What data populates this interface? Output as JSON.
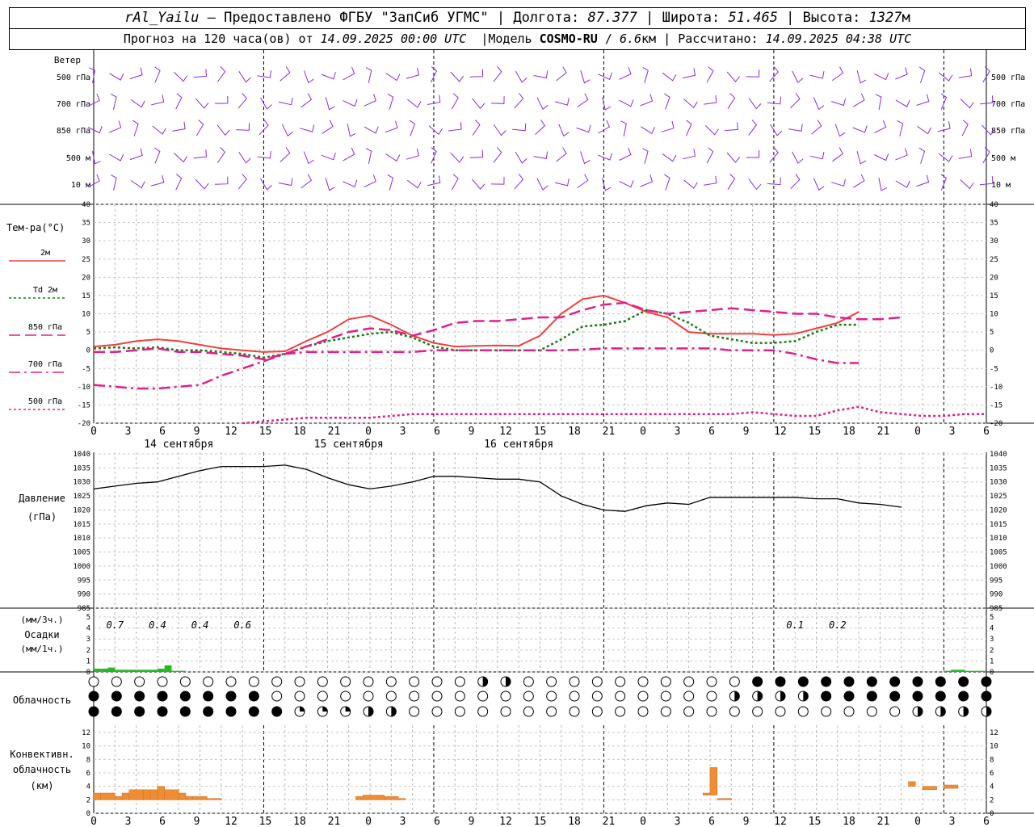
{
  "header": {
    "station": "rAl_Yailu",
    "provider": "— Предоставлено ФГБУ \"ЗапСиб УГМС\"",
    "lon_label": "Долгота:",
    "lon": "87.377",
    "lat_label": "Широта:",
    "lat": "51.465",
    "alt_label": "Высота:",
    "alt": "1327",
    "alt_unit": "м",
    "forecast_label": "Прогноз на 120 часа(ов) от",
    "forecast_start": "14.09.2025 00:00 UTC",
    "model_label": "Модель",
    "model_name": "COSMO-RU",
    "model_res": "6.6",
    "model_res_unit": "км",
    "computed_label": "Рассчитано:",
    "computed": "14.09.2025 04:38 UTC"
  },
  "wind_panel": {
    "title": "Ветер",
    "levels": [
      "500 гПа",
      "700 гПа",
      "850 гПа",
      "500 м",
      "10 м"
    ],
    "color": "#8a2be2"
  },
  "temp_panel": {
    "title": "Тем-ра(°С)",
    "legend": [
      {
        "label": "2м",
        "color": "#f04040",
        "style": "solid"
      },
      {
        "label": "Td 2м",
        "color": "#1a7a1a",
        "style": "dotted"
      },
      {
        "label": "850 гПа",
        "color": "#e0208a",
        "style": "dashed"
      },
      {
        "label": "700 гПа",
        "color": "#e0208a",
        "style": "dashdot"
      },
      {
        "label": "500 гПа",
        "color": "#e0208a",
        "style": "dotted"
      }
    ],
    "yticks": [
      "40",
      "35",
      "30",
      "25",
      "20",
      "15",
      "10",
      "5",
      "0",
      "-5",
      "-10",
      "-15",
      "-20"
    ]
  },
  "hour_ticks": [
    "0",
    "3",
    "6",
    "9",
    "12",
    "15",
    "18",
    "21",
    "0",
    "3",
    "6",
    "9",
    "12",
    "15",
    "18",
    "21",
    "0",
    "3",
    "6",
    "9",
    "12",
    "15",
    "18",
    "21",
    "0",
    "3",
    "6"
  ],
  "day_labels": [
    "14 сентября",
    "15 сентября",
    "16 сентября"
  ],
  "pressure_panel": {
    "title": "Давление",
    "unit": "(гПа)",
    "yticks": [
      "1040",
      "1035",
      "1030",
      "1025",
      "1020",
      "1015",
      "1010",
      "1005",
      "1000",
      "995",
      "990",
      "985"
    ]
  },
  "precip_panel": {
    "unit_top": "(мм/3ч.)",
    "title": "Осадки",
    "unit_bottom": "(мм/1ч.)",
    "yticks": [
      "5",
      "4",
      "3",
      "2",
      "1",
      "0"
    ],
    "labels": [
      {
        "text": "0.7",
        "h": 3
      },
      {
        "text": "0.4",
        "h": 9
      },
      {
        "text": "0.4",
        "h": 15
      },
      {
        "text": "0.6",
        "h": 21
      },
      {
        "text": "0.1",
        "h": 99
      },
      {
        "text": "0.2",
        "h": 105
      }
    ]
  },
  "cloud_panel": {
    "title": "Облачность"
  },
  "conv_panel": {
    "title_1": "Конвективн.",
    "title_2": "облачность",
    "unit": "(км)",
    "yticks": [
      "12",
      "10",
      "8",
      "6",
      "4",
      "2",
      "0"
    ]
  },
  "chart_data": {
    "type": "line",
    "x_unit": "hours from 14.09.2025 00:00 UTC",
    "xlim": [
      0,
      126
    ],
    "temperature": {
      "ylim": [
        -20,
        40
      ],
      "series": [
        {
          "name": "2м",
          "x": [
            0,
            3,
            6,
            9,
            12,
            15,
            18,
            21,
            24,
            27,
            30,
            33,
            36,
            39,
            42,
            45,
            48,
            51,
            54,
            57,
            60,
            63,
            66,
            69,
            72,
            75,
            78,
            81,
            84,
            87,
            90,
            93,
            96,
            99,
            102,
            105,
            108,
            111,
            114,
            117,
            120,
            123,
            126
          ],
          "values": [
            1,
            1.5,
            2.5,
            3,
            2.5,
            1.5,
            0.5,
            0,
            -0.5,
            -0.3,
            2.5,
            5,
            8.5,
            9.5,
            7,
            4,
            2,
            1,
            1.2,
            1.3,
            1.2,
            4,
            10,
            14,
            15,
            13,
            10.5,
            9,
            5,
            4.5,
            4.5,
            4.5,
            4.2,
            4.5,
            6,
            7.5,
            10.5
          ]
        },
        {
          "name": "Td 2м",
          "x": [
            0,
            3,
            6,
            9,
            12,
            15,
            18,
            21,
            24,
            27,
            30,
            33,
            36,
            39,
            42,
            45,
            48,
            51,
            54,
            57,
            60,
            63,
            66,
            69,
            72,
            75,
            78,
            81,
            84,
            87,
            90,
            93,
            96,
            99,
            102,
            105,
            108,
            111,
            114,
            117,
            120,
            123,
            126
          ],
          "values": [
            0.5,
            0.8,
            0.5,
            0.8,
            0,
            0,
            -0.5,
            -1,
            -2,
            -1,
            1,
            2.5,
            3.5,
            4.5,
            5,
            3.5,
            1,
            0,
            0,
            0,
            0,
            0,
            3,
            6.5,
            7,
            8,
            11,
            10,
            7.5,
            4,
            3,
            2,
            2,
            2.5,
            5,
            7,
            7
          ]
        },
        {
          "name": "850 гПа",
          "x": [
            0,
            3,
            6,
            9,
            12,
            15,
            18,
            21,
            24,
            27,
            30,
            33,
            36,
            39,
            42,
            45,
            48,
            51,
            54,
            57,
            60,
            63,
            66,
            69,
            72,
            75,
            78,
            81,
            84,
            87,
            90,
            93,
            96,
            99,
            102,
            105,
            108,
            111,
            114,
            117,
            120,
            123,
            126
          ],
          "values": [
            -0.5,
            -0.5,
            0,
            0.5,
            -0.5,
            -0.5,
            -1,
            -1.5,
            -2.5,
            -1,
            1,
            3,
            5,
            6,
            5.5,
            4,
            5.5,
            7.5,
            8,
            8,
            8.5,
            9,
            9,
            11,
            12.5,
            13,
            11,
            10,
            10.5,
            11,
            11.5,
            11,
            10.5,
            10,
            10,
            9,
            8.5,
            8.5,
            9
          ]
        },
        {
          "name": "700 гПа",
          "x": [
            0,
            3,
            6,
            9,
            12,
            15,
            18,
            21,
            24,
            27,
            30,
            33,
            36,
            39,
            42,
            45,
            48,
            51,
            54,
            57,
            60,
            63,
            66,
            69,
            72,
            75,
            78,
            81,
            84,
            87,
            90,
            93,
            96,
            99,
            102,
            105,
            108,
            111,
            114,
            117,
            120,
            123,
            126
          ],
          "values": [
            -9.5,
            -10,
            -10.5,
            -10.5,
            -10,
            -9.5,
            -7,
            -5,
            -3,
            -1,
            -0.5,
            -0.5,
            -0.5,
            -0.5,
            -0.5,
            -0.5,
            0,
            0,
            0,
            0,
            0,
            0,
            0,
            0.2,
            0.5,
            0.5,
            0.5,
            0.5,
            0.5,
            0.5,
            0,
            0,
            0,
            -1,
            -2.5,
            -3.5,
            -3.5
          ]
        },
        {
          "name": "500 гПа",
          "x": [
            21,
            24,
            27,
            30,
            33,
            36,
            39,
            42,
            45,
            48,
            51,
            54,
            57,
            60,
            63,
            66,
            69,
            72,
            75,
            78,
            81,
            84,
            87,
            90,
            93,
            96,
            99,
            102,
            105,
            108,
            111,
            114,
            117,
            120,
            123,
            126
          ],
          "values": [
            -20,
            -19.5,
            -19,
            -18.5,
            -18.5,
            -18.5,
            -18.5,
            -18,
            -17.5,
            -17.5,
            -17.5,
            -17.5,
            -17.5,
            -17.5,
            -17.5,
            -17.5,
            -17.5,
            -17.5,
            -17.5,
            -17.5,
            -17.5,
            -17.5,
            -17.5,
            -17.5,
            -17,
            -17.5,
            -18,
            -18,
            -16.5,
            -15.5,
            -17,
            -17.5,
            -18,
            -18,
            -17.5,
            -17.5
          ]
        }
      ]
    },
    "pressure": {
      "ylim": [
        985,
        1040
      ],
      "series": [
        {
          "name": "Давление",
          "x": [
            0,
            3,
            6,
            9,
            12,
            15,
            18,
            21,
            24,
            27,
            30,
            33,
            36,
            39,
            42,
            45,
            48,
            51,
            54,
            57,
            60,
            63,
            66,
            69,
            72,
            75,
            78,
            81,
            84,
            87,
            90,
            93,
            96,
            99,
            102,
            105,
            108,
            111,
            114,
            117,
            120,
            123,
            126
          ],
          "values": [
            1027.5,
            1028.5,
            1029.5,
            1030,
            1032,
            1034,
            1035.5,
            1035.5,
            1035.5,
            1036,
            1034.5,
            1031.5,
            1029,
            1027.5,
            1028.5,
            1030,
            1032,
            1032,
            1031.5,
            1031,
            1031,
            1030,
            1025,
            1022,
            1020,
            1019.5,
            1021.5,
            1022.5,
            1022,
            1024.5,
            1024.5,
            1024.5,
            1024.5,
            1024.5,
            1024,
            1024,
            1022.5,
            1022,
            1021
          ]
        }
      ]
    },
    "precipitation_1h": {
      "ylim": [
        0,
        5
      ],
      "series": [
        {
          "name": "осадки",
          "color": "#22bb22",
          "x": [
            0,
            1,
            2,
            3,
            4,
            5,
            6,
            7,
            8,
            9,
            10,
            11,
            12,
            13,
            14,
            99,
            100,
            101,
            102,
            103,
            104,
            105,
            106,
            107,
            108,
            109,
            110,
            111,
            112,
            113,
            114,
            115,
            116,
            117,
            118,
            119,
            120,
            121,
            122,
            123,
            124,
            125
          ],
          "values": [
            0.3,
            0.3,
            0.4,
            0.2,
            0.2,
            0.2,
            0.2,
            0.2,
            0.2,
            0.3,
            0.6,
            0.1,
            0.1,
            0,
            0,
            0,
            0,
            0,
            0,
            0,
            0,
            0,
            0,
            0,
            0,
            0,
            0,
            0,
            0,
            0,
            0,
            0,
            0,
            0,
            0,
            0,
            0.1,
            0.2,
            0.2,
            0.1,
            0.1,
            0.1
          ]
        }
      ]
    },
    "convective_cloud_km": {
      "ylim": [
        0,
        12
      ],
      "bars": [
        {
          "x0": 0,
          "x1": 1,
          "base": 2,
          "top": 3
        },
        {
          "x0": 1,
          "x1": 3,
          "base": 2,
          "top": 3
        },
        {
          "x0": 3,
          "x1": 4,
          "base": 2,
          "top": 2.5
        },
        {
          "x0": 4,
          "x1": 5,
          "base": 2,
          "top": 3
        },
        {
          "x0": 5,
          "x1": 7,
          "base": 2,
          "top": 3.5
        },
        {
          "x0": 7,
          "x1": 8,
          "base": 2,
          "top": 3.5
        },
        {
          "x0": 8,
          "x1": 9,
          "base": 2,
          "top": 3.5
        },
        {
          "x0": 9,
          "x1": 10,
          "base": 2,
          "top": 4
        },
        {
          "x0": 10,
          "x1": 12,
          "base": 2,
          "top": 3.5
        },
        {
          "x0": 12,
          "x1": 13,
          "base": 2,
          "top": 3
        },
        {
          "x0": 13,
          "x1": 14,
          "base": 2,
          "top": 2.5
        },
        {
          "x0": 14,
          "x1": 16,
          "base": 2,
          "top": 2.5
        },
        {
          "x0": 16,
          "x1": 17,
          "base": 2,
          "top": 2.2
        },
        {
          "x0": 17,
          "x1": 18,
          "base": 2,
          "top": 2.2
        },
        {
          "x0": 37,
          "x1": 38,
          "base": 2,
          "top": 2.5
        },
        {
          "x0": 38,
          "x1": 41,
          "base": 2,
          "top": 2.7
        },
        {
          "x0": 41,
          "x1": 43,
          "base": 2,
          "top": 2.5
        },
        {
          "x0": 43,
          "x1": 44,
          "base": 2,
          "top": 2.2
        },
        {
          "x0": 86,
          "x1": 87,
          "base": 2.7,
          "top": 3
        },
        {
          "x0": 87,
          "x1": 88,
          "base": 2.7,
          "top": 6.8
        },
        {
          "x0": 88,
          "x1": 90,
          "base": 2,
          "top": 2.2
        },
        {
          "x0": 115,
          "x1": 116,
          "base": 4,
          "top": 4.7
        },
        {
          "x0": 117,
          "x1": 119,
          "base": 3.5,
          "top": 4
        },
        {
          "x0": 120,
          "x1": 122,
          "base": 3.7,
          "top": 4.2
        }
      ]
    },
    "cloud_cover": {
      "rows": 3,
      "per_row_symbols": 40
    }
  }
}
